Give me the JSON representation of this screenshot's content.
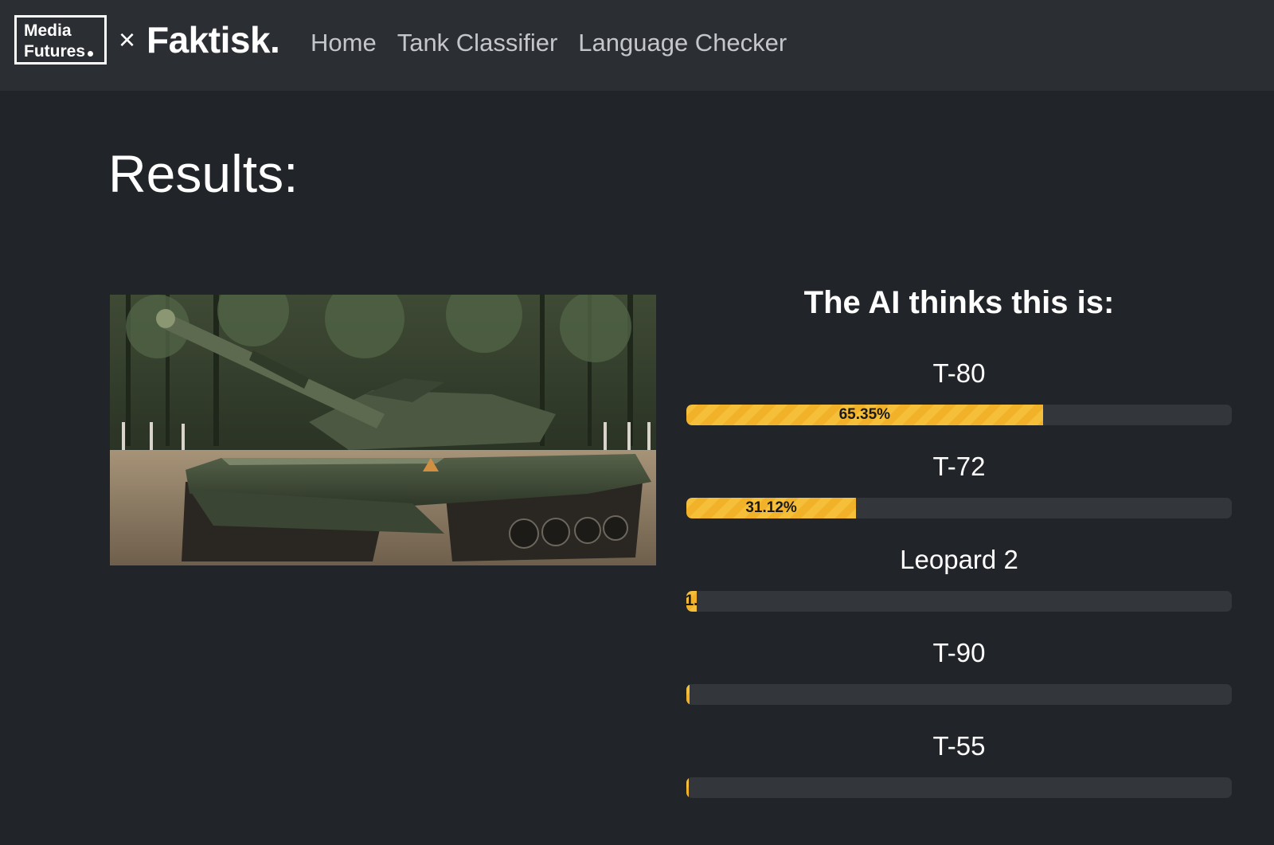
{
  "navbar": {
    "logo_line1": "Media",
    "logo_line2": "Futures",
    "logo_x": "×",
    "brand": "Faktisk.",
    "links": [
      "Home",
      "Tank Classifier",
      "Language Checker"
    ]
  },
  "page": {
    "title": "Results:"
  },
  "results": {
    "heading": "The AI thinks this is:",
    "items": [
      {
        "label": "T-80",
        "percent_text": "65.35%",
        "percent": 65.35
      },
      {
        "label": "T-72",
        "percent_text": "31.12%",
        "percent": 31.12
      },
      {
        "label": "Leopard 2",
        "percent_text": "1.",
        "percent": 1.9
      },
      {
        "label": "T-90",
        "percent_text": "",
        "percent": 0.6
      },
      {
        "label": "T-55",
        "percent_text": "",
        "percent": 0.3
      }
    ]
  },
  "colors": {
    "background": "#212429",
    "navbar": "#2b2e33",
    "bar_fill": "#f6bf3a",
    "bar_track": "#33373c"
  }
}
